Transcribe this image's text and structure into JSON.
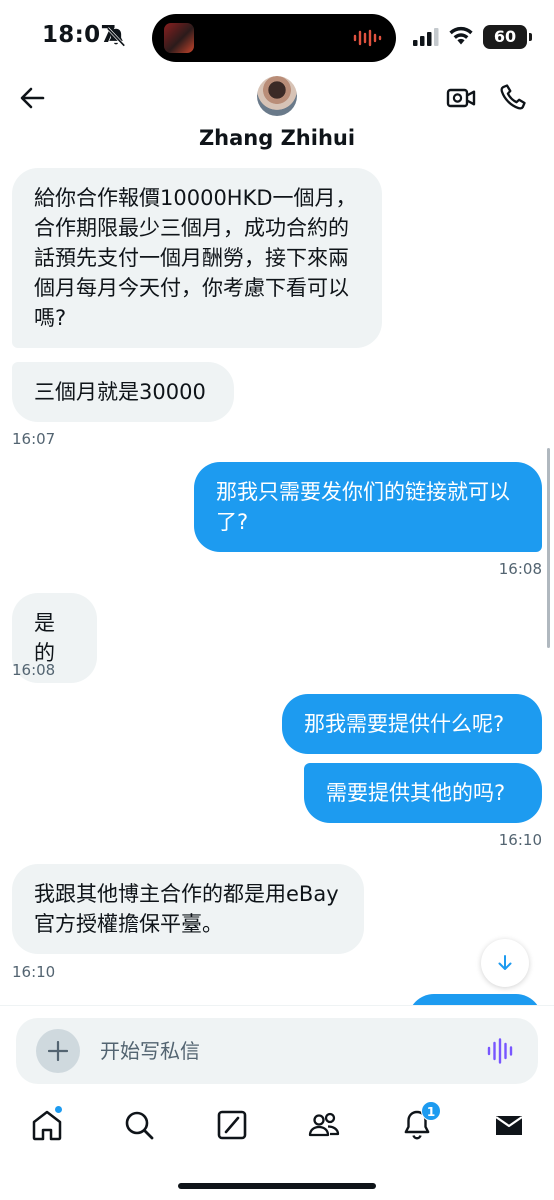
{
  "status_bar": {
    "time": "18:07",
    "battery": "60",
    "icons": [
      "bell-off-icon",
      "audio-wave-icon",
      "cellular-signal-icon",
      "wifi-icon",
      "battery-icon"
    ]
  },
  "header": {
    "contact_name": "Zhang Zhihui",
    "icons": [
      "back-arrow-icon",
      "video-call-icon",
      "phone-call-icon"
    ]
  },
  "messages": [
    {
      "side": "in",
      "text": "給你合作報價10000HKD一個月，合作期限最少三個月，成功合約的話預先支付一個月酬勞，接下來兩個月每月今天付，你考慮下看可以嗎?"
    },
    {
      "side": "in",
      "text": "三個月就是30000",
      "time": "16:07"
    },
    {
      "side": "out",
      "text": "那我只需要发你们的链接就可以了?",
      "time": "16:08"
    },
    {
      "side": "in",
      "text": "是的",
      "time": "16:08"
    },
    {
      "side": "out",
      "text": "那我需要提供什么呢?"
    },
    {
      "side": "out",
      "text": "需要提供其他的吗?",
      "time": "16:10"
    },
    {
      "side": "in",
      "text": "我跟其他博主合作的都是用eBay官方授權擔保平臺。",
      "time": "16:10"
    }
  ],
  "composer": {
    "placeholder": "开始写私信",
    "icons": [
      "plus-icon",
      "voice-wave-icon"
    ]
  },
  "tabbar": {
    "tabs": [
      "home",
      "search",
      "grok",
      "communities",
      "notifications",
      "messages"
    ],
    "notification_count": "1"
  },
  "colors": {
    "accent": "#1d9bf0",
    "incoming_bubble": "#eff3f4",
    "outgoing_bubble": "#1d9bf0",
    "voice_icon": "#7856ff"
  }
}
